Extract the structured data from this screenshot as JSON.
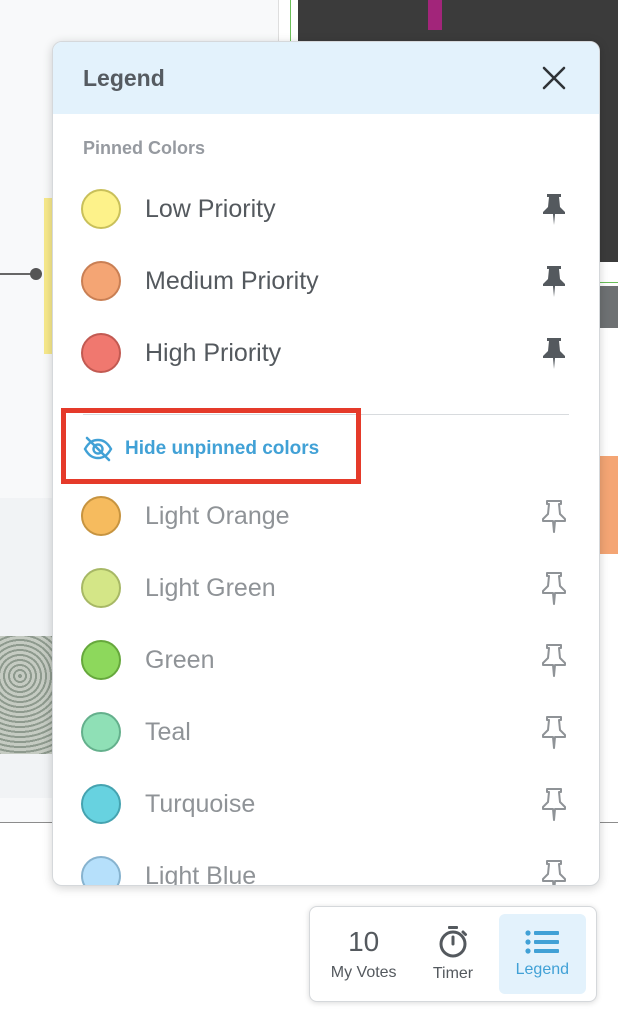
{
  "legend": {
    "title": "Legend",
    "pinned_section_label": "Pinned Colors",
    "pinned": [
      {
        "label": "Low Priority",
        "color": "#fdf28a",
        "border": "#c9c05a"
      },
      {
        "label": "Medium Priority",
        "color": "#f4a574",
        "border": "#c97f54"
      },
      {
        "label": "High Priority",
        "color": "#f0786f",
        "border": "#c25a52"
      }
    ],
    "hide_unpinned_label": "Hide unpinned colors",
    "unpinned": [
      {
        "label": "Light Orange",
        "color": "#f6bb5e",
        "border": "#c79440"
      },
      {
        "label": "Light Green",
        "color": "#d4e687",
        "border": "#a7b865"
      },
      {
        "label": "Green",
        "color": "#8dd85c",
        "border": "#66a83c"
      },
      {
        "label": "Teal",
        "color": "#8fe0b6",
        "border": "#64b08c"
      },
      {
        "label": "Turquoise",
        "color": "#67d2e0",
        "border": "#45a3b0"
      },
      {
        "label": "Light Blue",
        "color": "#b6e0fb",
        "border": "#87b3cf"
      }
    ],
    "icons": {
      "close": "close-icon",
      "pinned": "pin-filled-icon",
      "unpinned": "pin-outline-icon",
      "hide": "eye-slash-icon"
    },
    "accent_color": "#41a1d6",
    "highlight_color": "#e53a2a"
  },
  "toolbar": {
    "votes": {
      "count": "10",
      "label": "My Votes"
    },
    "timer": {
      "label": "Timer"
    },
    "legend": {
      "label": "Legend"
    }
  }
}
